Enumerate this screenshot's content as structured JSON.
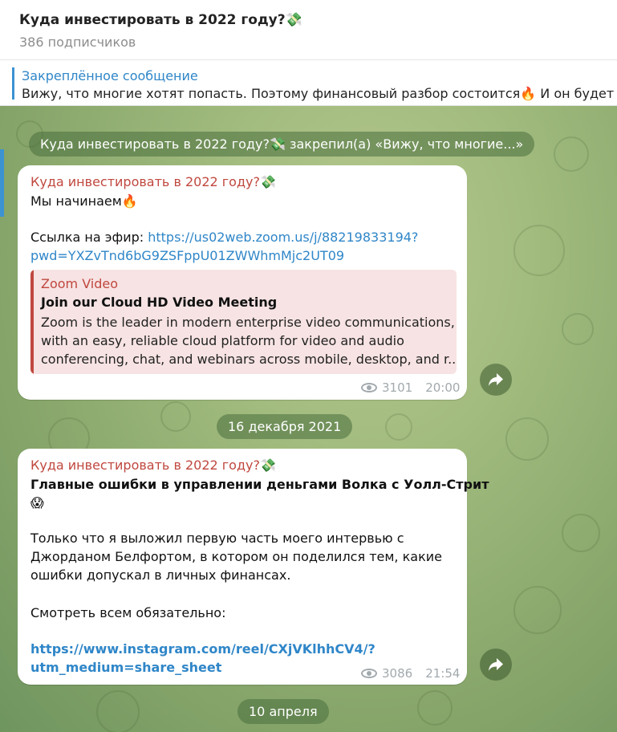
{
  "header": {
    "title": "Куда инвестировать в 2022 году?💸",
    "subscribers": "386 подписчиков"
  },
  "pinned": {
    "label": "Закреплённое сообщение",
    "text": "Вижу, что многие хотят попасть. Поэтому финансовый разбор состоится🔥  И он будет бе"
  },
  "service": {
    "pinned_notice": "Куда инвестировать в 2022 году?💸 закрепил(а) «Вижу, что многие...»"
  },
  "messages": [
    {
      "sender": "Куда инвестировать в 2022 году?💸",
      "text_line1": "Мы начинаем🔥",
      "link_prefix": "Ссылка на эфир: ",
      "link_part1": "https://us02web.zoom.us/j/88219833194?",
      "link_part2": "pwd=YXZvTnd6bG9ZSFppU01ZWWhmMjc2UT09",
      "preview": {
        "site": "Zoom Video",
        "title": "Join our Cloud HD Video Meeting",
        "desc_line1": "Zoom is the leader in modern enterprise video communications,",
        "desc_line2": "with an easy, reliable cloud platform for video and audio",
        "desc_line3": "conferencing, chat, and webinars across mobile, desktop, and r..."
      },
      "views": "3101",
      "time": "20:00"
    },
    {
      "sender": "Куда инвестировать в 2022 году?💸",
      "title": "Главные ошибки в управлении деньгами Волка с Уолл-Стрит",
      "title_emoji": "😱",
      "body_line1": "Только что я выложил первую часть моего интервью с",
      "body_line2": "Джорданом Белфортом, в котором он поделился тем, какие",
      "body_line3": "ошибки допускал в личных финансах.",
      "body_line4": "Смотреть всем обязательно:",
      "link_part1": "https://www.instagram.com/reel/CXjVKlhhCV4/?",
      "link_part2": "utm_medium=share_sheet",
      "views": "3086",
      "time": "21:54"
    }
  ],
  "dates": {
    "date1": "16 декабря 2021",
    "date2": "10 апреля"
  },
  "colors": {
    "accent": "#2f86c8",
    "sender": "#c0483f",
    "preview_bg": "#f7e3e3"
  }
}
